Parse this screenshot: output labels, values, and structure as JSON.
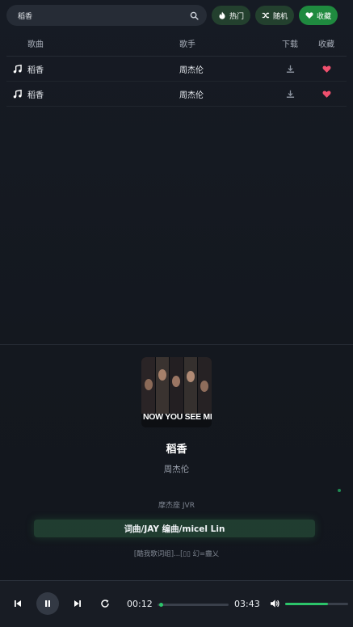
{
  "search": {
    "value": "稻香"
  },
  "buttons": {
    "hot": "热门",
    "random": "随机",
    "favorite": "收藏"
  },
  "table": {
    "headers": {
      "song": "歌曲",
      "artist": "歌手",
      "download": "下载",
      "favorite": "收藏"
    },
    "rows": [
      {
        "song": "稻香",
        "artist": "周杰伦"
      },
      {
        "song": "稻香",
        "artist": "周杰伦"
      }
    ]
  },
  "album": {
    "cover_text": "NOW YOU SEE ME2"
  },
  "now_playing": {
    "title": "稻香",
    "artist": "周杰伦",
    "lyrics": {
      "prev": "摩杰座 JVR",
      "current": "词曲/JAY 编曲/micel Lin",
      "next": "[酷我歌词组]...[▯▯ 幻=霾乂"
    }
  },
  "player": {
    "current_time": "00:12",
    "duration": "03:43",
    "progress": 0.05,
    "volume": 0.68
  },
  "colors": {
    "accent": "#2cc46a",
    "favorite_heart": "#f0506e",
    "button_green": "#1f8a3f"
  },
  "icons": [
    "search-icon",
    "fire-icon",
    "shuffle-icon",
    "heart-icon",
    "music-note-icon",
    "download-icon",
    "previous-icon",
    "pause-icon",
    "next-icon",
    "repeat-icon",
    "volume-icon"
  ]
}
